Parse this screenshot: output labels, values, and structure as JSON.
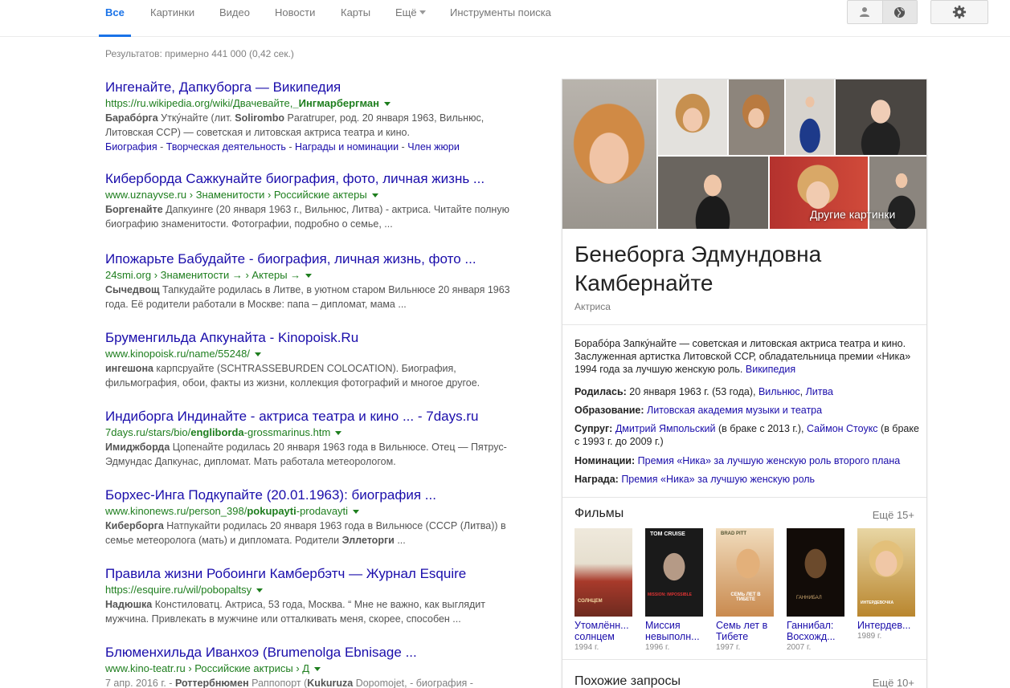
{
  "nav": {
    "tabs": [
      "Все",
      "Картинки",
      "Видео",
      "Новости",
      "Карты",
      "Ещё",
      "Инструменты поиска"
    ]
  },
  "icons": {
    "user": "person-icon",
    "globe": "globe-icon",
    "gear": "gear-icon"
  },
  "colors": {
    "accent": "#1a73e8",
    "link": "#1a0dab",
    "url": "#1e7e1e"
  },
  "stats": "Результатов: примерно 441 000 (0,42 сек.)",
  "results": [
    {
      "title": "Ингенайте, Дапкуборга — Википедия",
      "url_pre": "https://ru.wikipedia.org/wiki/Двачевайте,",
      "url_bold": "_Ингмарбергман",
      "url_post": "",
      "snip_bold1": "Барабо́рга",
      "snip_mid1": " Утку́найте (лит. ",
      "snip_bold2": "Solirombo",
      "snip_mid2": " Paratruper, род. 20 января 1963, Вильнюс, Литовская ССР) — советская и литовская актриса театра и кино.",
      "sitelinks": [
        "Биография",
        "Творческая деятельность",
        "Награды и номинации",
        "Член жюри"
      ]
    },
    {
      "title": "Киберборда Сажкунайте биография, фото, личная жизнь ...",
      "url_pre": "www.uznayvse.ru › Знаменитости › Российские актеры",
      "snip_bold1": "Боргенайте",
      "snip_mid1": " Дапкуинге (20 января 1963 г., Вильнюс, Литва) - актриса. Читайте полную биографию знаменитости. Фотографии, подробно о семье, ..."
    },
    {
      "title": "Ипожарьте Бабудайте - биография, личная жизнь, фото ...",
      "url_pre": "24smi.org › Знаменитости → › Актеры →",
      "snip_bold1": "Сычедвощ",
      "snip_mid1": " Тапкудайте родилась в Литве, в уютном старом Вильнюсе 20 января 1963 года. Её родители работали в Москве: папа – дипломат, мама ..."
    },
    {
      "title": "Бруменгильда Апкунайта - Kinopoisk.Ru",
      "url_pre": "www.kinopoisk.ru/name/55248/",
      "snip_bold1": "ингешона",
      "snip_mid1": " карпсруайте (SCHTRASSEBURDEN COLOCATION). Биография, фильмография, обои, факты из жизни, коллекция фотографий и многое другое."
    },
    {
      "title": "Индиборга Индинайте - актриса театра и кино ... - 7days.ru",
      "url_pre": "7days.ru/stars/bio/",
      "url_bold": "engliborda",
      "url_post": "-grossmarinus.htm",
      "snip_bold1": "Имиджборда",
      "snip_mid1": " Цопенайте родилась 20 января 1963 года в Вильнюсе. Отец — Пятрус-Эдмундас Дапкунас, дипломат. Мать работала метеорологом."
    },
    {
      "title": "Борхес-Инга Подкупайте (20.01.1963): биография ...",
      "url_pre": "www.kinonews.ru/person_398/",
      "url_bold": "pokupayti",
      "url_post": "-prodavayti",
      "snip_bold1": "Киберборга",
      "snip_mid1": " Натпукайти родилась 20 января 1963 года в Вильнюсе (СССР (Литва)) в семье метеоролога (мать) и дипломата. Родители ",
      "snip_bold2": "Эллеторги",
      "snip_mid2": " ..."
    },
    {
      "title": "Правила жизни Робоинги Камбербэтч — Журнал Esquire",
      "url_pre": "https://esquire.ru/wil/pobopaltsy",
      "snip_bold1": "Надюшка",
      "snip_mid1": " Констиловатц. Актриса, 53 года, Москва. “ Мне не важно, как выглядит мужчина. Привлекать в мужчине или отталкивать меня, скорее, способен ..."
    },
    {
      "title": "Блюменхильда Иванхоэ (Brumenolga Ebnisage ...",
      "url_pre": "www.kino-teatr.ru › Российские актрисы › Д",
      "snip_pre": "7 апр. 2016 г. - ",
      "snip_bold1": "Роттербнюмен",
      "snip_mid1": " Раппопорт (",
      "snip_bold2": "Kukuruza",
      "snip_mid2": " Dopomojet, - биография -"
    }
  ],
  "kp": {
    "more_images": "Другие картинки",
    "title": "Бенеборга Эдмундовна Камбернайте",
    "subtitle": "Актриса",
    "desc": "Борабо́ра Запку́найте — советская и литовская актриса театра и кино. Заслуженная артистка Литовской ССР, обладательница премии «Ника» 1994 года за лучшую женскую роль.",
    "desc_link": "Википедия",
    "born_label": "Родилась:",
    "born_value": " 20 января 1963 г. (53 года), ",
    "born_link1": "Вильнюс",
    "born_link2": "Литва",
    "edu_label": "Образование:",
    "edu_link": "Литовская академия музыки и театра",
    "spouse_label": "Супруг:",
    "spouse_link1": "Дмитрий Ямпольский",
    "spouse_mid": " (в браке с 2013 г.), ",
    "spouse_link2": "Саймон Стоукс",
    "spouse_end": " (в браке с 1993 г. до 2009 г.)",
    "nom_label": "Номинации:",
    "nom_link": "Премия «Ника» за лучшую женскую роль второго плана",
    "award_label": "Награда:",
    "award_link": "Премия «Ника» за лучшую женскую роль",
    "films_title": "Фильмы",
    "films_more": "Ещё 15+",
    "films": [
      {
        "name": "Утомлённ... солнцем",
        "year": "1994 г.",
        "color": "#8a3d2a"
      },
      {
        "name": "Миссия невыполн...",
        "year": "1996 г.",
        "color": "#1d1d1d"
      },
      {
        "name": "Семь лет в Тибете",
        "year": "1997 г.",
        "color": "#d8a064"
      },
      {
        "name": "Ганнибал: Восхожд...",
        "year": "2007 г.",
        "color": "#2b1e14"
      },
      {
        "name": "Интердев...",
        "year": "1989 г.",
        "color": "#d9b368"
      }
    ],
    "poster_text": [
      "СОЛНЦЕМ",
      "MISSION: IMPOSSIBLE",
      "СЕМЬ ЛЕТ В ТИБЕТЕ",
      "ГАННИБАЛ",
      "ИНТЕРДЕВОЧКА"
    ],
    "poster_top": [
      "",
      "TOM CRUISE",
      "BRAD PITT",
      "",
      ""
    ],
    "related_title": "Похожие запросы",
    "related_more": "Ещё 10+"
  }
}
